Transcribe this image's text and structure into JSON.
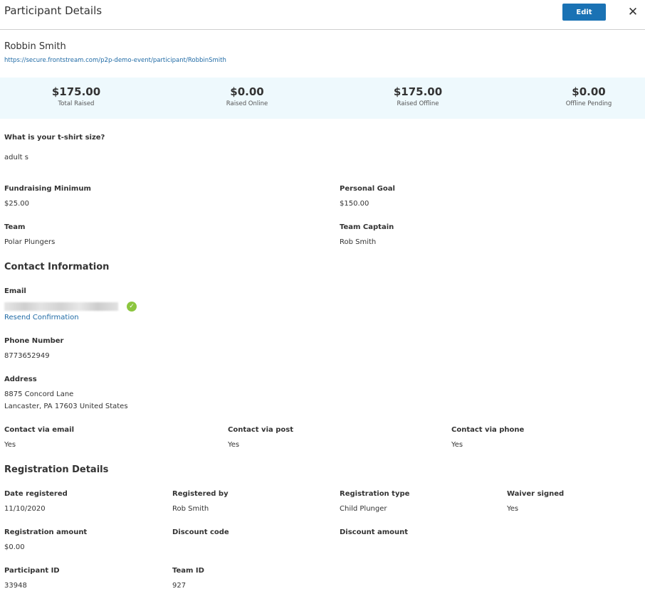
{
  "header": {
    "title": "Participant Details",
    "edit_label": "Edit",
    "close_glyph": "✕"
  },
  "participant": {
    "name": "Robbin Smith",
    "url": "https://secure.frontstream.com/p2p-demo-event/participant/RobbinSmith"
  },
  "stats": [
    {
      "value": "$175.00",
      "label": "Total Raised"
    },
    {
      "value": "$0.00",
      "label": "Raised Online"
    },
    {
      "value": "$175.00",
      "label": "Raised Offline"
    },
    {
      "value": "$0.00",
      "label": "Offline Pending"
    }
  ],
  "tshirt": {
    "label": "What is your t-shirt size?",
    "value": "adult s"
  },
  "fundraising": {
    "min_label": "Fundraising Minimum",
    "min_value": "$25.00",
    "goal_label": "Personal Goal",
    "goal_value": "$150.00",
    "team_label": "Team",
    "team_value": "Polar Plungers",
    "captain_label": "Team Captain",
    "captain_value": "Rob Smith"
  },
  "contact": {
    "heading": "Contact Information",
    "email_label": "Email",
    "resend_label": "Resend Confirmation",
    "verified_glyph": "✓",
    "phone_label": "Phone Number",
    "phone_value": "8773652949",
    "address_label": "Address",
    "address_line1": "8875 Concord Lane",
    "address_line2": "Lancaster, PA 17603 United States",
    "via_email_label": "Contact via email",
    "via_email_value": "Yes",
    "via_post_label": "Contact via post",
    "via_post_value": "Yes",
    "via_phone_label": "Contact via phone",
    "via_phone_value": "Yes"
  },
  "registration": {
    "heading": "Registration Details",
    "date_label": "Date registered",
    "date_value": "11/10/2020",
    "by_label": "Registered by",
    "by_value": "Rob Smith",
    "type_label": "Registration type",
    "type_value": "Child Plunger",
    "waiver_label": "Waiver signed",
    "waiver_value": "Yes",
    "amount_label": "Registration amount",
    "amount_value": "$0.00",
    "discount_code_label": "Discount code",
    "discount_amount_label": "Discount amount",
    "pid_label": "Participant ID",
    "pid_value": "33948",
    "tid_label": "Team ID",
    "tid_value": "927"
  },
  "colors": {
    "accent": "#1a72b4",
    "link": "#1f6aa5",
    "stats_bg": "#eef9fd",
    "verified": "#8cc63f"
  }
}
